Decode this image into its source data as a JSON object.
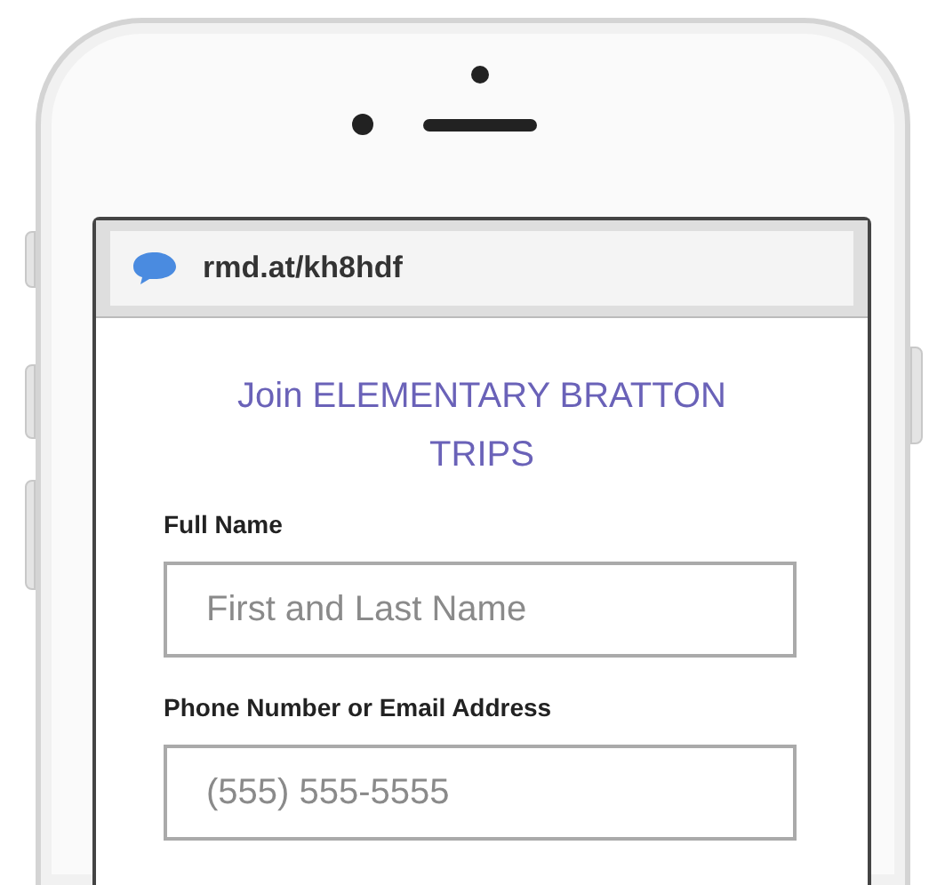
{
  "address_bar": {
    "url": "rmd.at/kh8hdf"
  },
  "form": {
    "title": "Join ELEMENTARY BRATTON TRIPS",
    "fields": [
      {
        "label": "Full Name",
        "placeholder": "First and Last Name"
      },
      {
        "label": "Phone Number or Email Address",
        "placeholder": "(555) 555-5555"
      }
    ]
  }
}
